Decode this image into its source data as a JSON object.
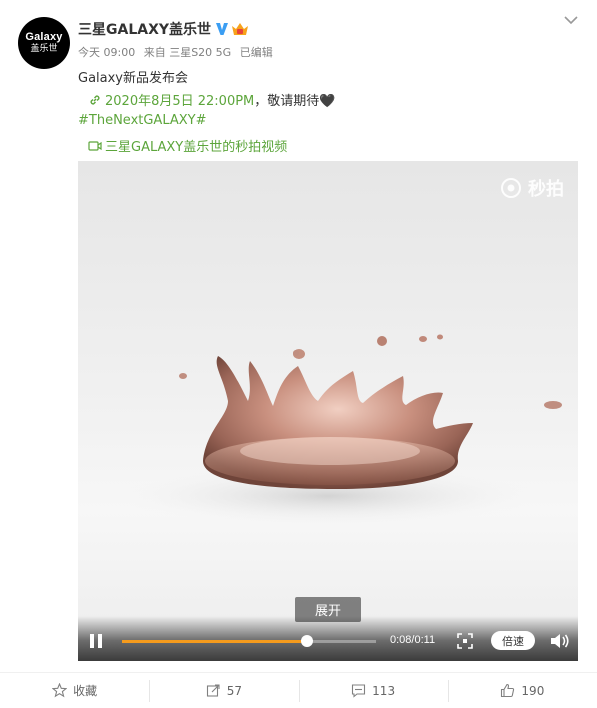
{
  "post": {
    "avatar_line1": "Galaxy",
    "avatar_line2": "盖乐世",
    "username": "三星GALAXY盖乐世",
    "meta": {
      "time": "今天 09:00",
      "source": "来自 三星S20 5G",
      "edited": "已编辑"
    },
    "line1": "Galaxy新品发布会",
    "date_link": "2020年8月5日 22:00PM",
    "line2_suffix": "，敬请期待🖤",
    "hashtag": "#TheNextGALAXY#",
    "video_link": "三星GALAXY盖乐世的秒拍视频"
  },
  "video": {
    "watermark": "秒拍",
    "expand_label": "展开",
    "time_display": "0:08/0:11",
    "speed_label": "倍速",
    "progress": 0.73
  },
  "actions": {
    "favorite": "收藏",
    "repost": "57",
    "comment": "113",
    "like": "190"
  },
  "colors": {
    "link": "#5ca53b",
    "progress": "#f59b1d",
    "verified": "#3b9ef3"
  },
  "icons": [
    "chevron-down-icon",
    "verified-icon",
    "member-icon",
    "link-icon",
    "video-icon",
    "miaopai-logo-icon",
    "pause-icon",
    "fullscreen-icon",
    "volume-icon",
    "star-icon",
    "repost-icon",
    "comment-icon",
    "like-icon"
  ]
}
